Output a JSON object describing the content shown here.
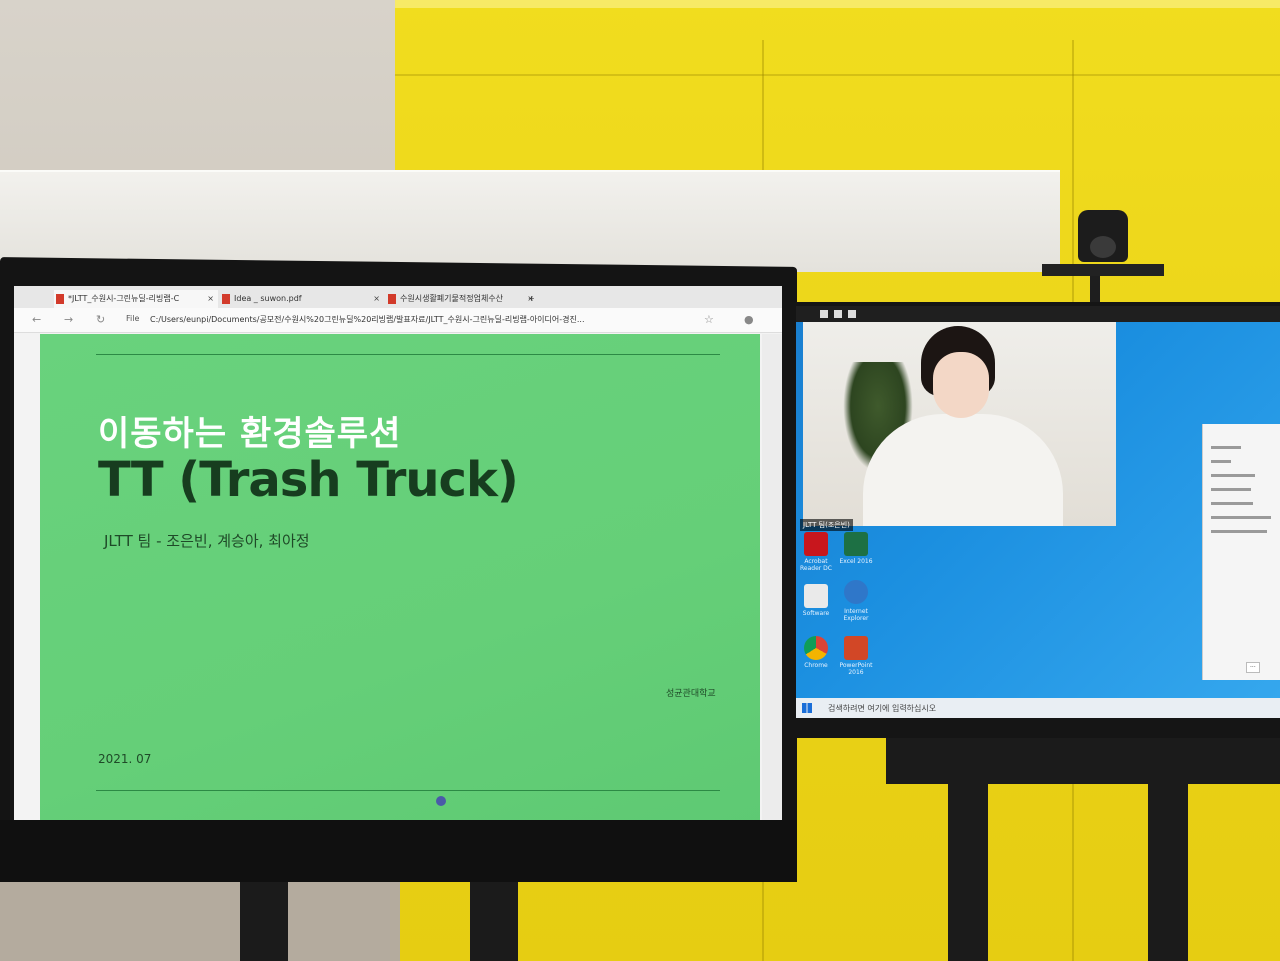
{
  "browser": {
    "tabs": [
      {
        "label": "*JLTT_수원시-그린뉴딜-리빙랩-C"
      },
      {
        "label": "Idea _ suwon.pdf"
      },
      {
        "label": "수원시생활폐기물적정업체수산"
      }
    ],
    "new_tab": "+",
    "file_label": "File",
    "address": "C:/Users/eunpi/Documents/공모전/수원시%20그린뉴딜%20리빙랩/발표자료/JLTT_수원시-그린뉴딜-리빙랩-아이디어-경진..."
  },
  "slide": {
    "title_korean": "이동하는 환경솔루션",
    "title_english": "TT (Trash Truck)",
    "team": "JLTT 팀 - 조은빈, 계승아, 최아정",
    "university": "성균관대학교",
    "date": "2021. 07"
  },
  "zoom": {
    "participant_name": "JLTT 팀(조은빈)"
  },
  "desktop": {
    "icons": [
      "Acrobat Reader DC",
      "Excel 2016",
      "Software",
      "Internet Explorer",
      "Chrome",
      "PowerPoint 2016"
    ],
    "taskbar_search": "검색하려면 여기에 입력하십시오"
  },
  "colors": {
    "slide_green": "#66d079",
    "title_dark": "#173d1f",
    "wall_yellow": "#ecd51a",
    "desktop_blue": "#1b8fe0"
  }
}
